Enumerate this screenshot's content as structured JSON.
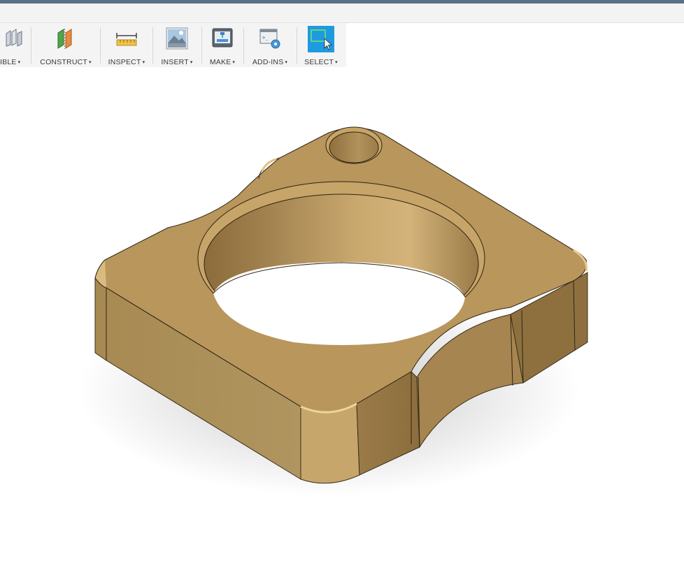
{
  "toolbar": {
    "groups": [
      {
        "label": "IBLE",
        "icon": "assemble-icon"
      },
      {
        "label": "CONSTRUCT",
        "icon": "construct-plane-icon"
      },
      {
        "label": "INSPECT",
        "icon": "measure-icon"
      },
      {
        "label": "INSERT",
        "icon": "insert-image-icon"
      },
      {
        "label": "MAKE",
        "icon": "3d-print-icon"
      },
      {
        "label": "ADD-INS",
        "icon": "scripts-addins-icon"
      },
      {
        "label": "SELECT",
        "icon": "window-select-icon"
      }
    ],
    "dropdown_glyph": "▾",
    "active_color": "#1d9be0"
  },
  "model": {
    "name": "brass-plate-model",
    "color": "#b8965c"
  }
}
